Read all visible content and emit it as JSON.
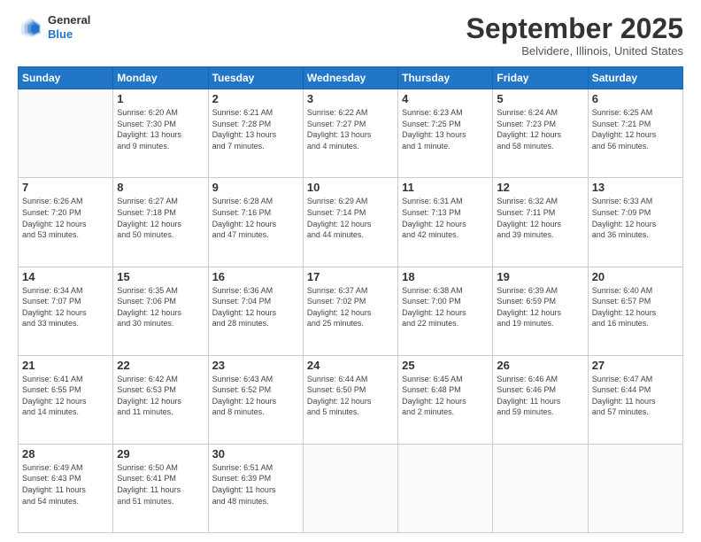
{
  "header": {
    "logo": {
      "general": "General",
      "blue": "Blue"
    },
    "title": "September 2025",
    "location": "Belvidere, Illinois, United States"
  },
  "calendar": {
    "headers": [
      "Sunday",
      "Monday",
      "Tuesday",
      "Wednesday",
      "Thursday",
      "Friday",
      "Saturday"
    ],
    "weeks": [
      [
        {
          "day": "",
          "info": ""
        },
        {
          "day": "1",
          "info": "Sunrise: 6:20 AM\nSunset: 7:30 PM\nDaylight: 13 hours\nand 9 minutes."
        },
        {
          "day": "2",
          "info": "Sunrise: 6:21 AM\nSunset: 7:28 PM\nDaylight: 13 hours\nand 7 minutes."
        },
        {
          "day": "3",
          "info": "Sunrise: 6:22 AM\nSunset: 7:27 PM\nDaylight: 13 hours\nand 4 minutes."
        },
        {
          "day": "4",
          "info": "Sunrise: 6:23 AM\nSunset: 7:25 PM\nDaylight: 13 hours\nand 1 minute."
        },
        {
          "day": "5",
          "info": "Sunrise: 6:24 AM\nSunset: 7:23 PM\nDaylight: 12 hours\nand 58 minutes."
        },
        {
          "day": "6",
          "info": "Sunrise: 6:25 AM\nSunset: 7:21 PM\nDaylight: 12 hours\nand 56 minutes."
        }
      ],
      [
        {
          "day": "7",
          "info": "Sunrise: 6:26 AM\nSunset: 7:20 PM\nDaylight: 12 hours\nand 53 minutes."
        },
        {
          "day": "8",
          "info": "Sunrise: 6:27 AM\nSunset: 7:18 PM\nDaylight: 12 hours\nand 50 minutes."
        },
        {
          "day": "9",
          "info": "Sunrise: 6:28 AM\nSunset: 7:16 PM\nDaylight: 12 hours\nand 47 minutes."
        },
        {
          "day": "10",
          "info": "Sunrise: 6:29 AM\nSunset: 7:14 PM\nDaylight: 12 hours\nand 44 minutes."
        },
        {
          "day": "11",
          "info": "Sunrise: 6:31 AM\nSunset: 7:13 PM\nDaylight: 12 hours\nand 42 minutes."
        },
        {
          "day": "12",
          "info": "Sunrise: 6:32 AM\nSunset: 7:11 PM\nDaylight: 12 hours\nand 39 minutes."
        },
        {
          "day": "13",
          "info": "Sunrise: 6:33 AM\nSunset: 7:09 PM\nDaylight: 12 hours\nand 36 minutes."
        }
      ],
      [
        {
          "day": "14",
          "info": "Sunrise: 6:34 AM\nSunset: 7:07 PM\nDaylight: 12 hours\nand 33 minutes."
        },
        {
          "day": "15",
          "info": "Sunrise: 6:35 AM\nSunset: 7:06 PM\nDaylight: 12 hours\nand 30 minutes."
        },
        {
          "day": "16",
          "info": "Sunrise: 6:36 AM\nSunset: 7:04 PM\nDaylight: 12 hours\nand 28 minutes."
        },
        {
          "day": "17",
          "info": "Sunrise: 6:37 AM\nSunset: 7:02 PM\nDaylight: 12 hours\nand 25 minutes."
        },
        {
          "day": "18",
          "info": "Sunrise: 6:38 AM\nSunset: 7:00 PM\nDaylight: 12 hours\nand 22 minutes."
        },
        {
          "day": "19",
          "info": "Sunrise: 6:39 AM\nSunset: 6:59 PM\nDaylight: 12 hours\nand 19 minutes."
        },
        {
          "day": "20",
          "info": "Sunrise: 6:40 AM\nSunset: 6:57 PM\nDaylight: 12 hours\nand 16 minutes."
        }
      ],
      [
        {
          "day": "21",
          "info": "Sunrise: 6:41 AM\nSunset: 6:55 PM\nDaylight: 12 hours\nand 14 minutes."
        },
        {
          "day": "22",
          "info": "Sunrise: 6:42 AM\nSunset: 6:53 PM\nDaylight: 12 hours\nand 11 minutes."
        },
        {
          "day": "23",
          "info": "Sunrise: 6:43 AM\nSunset: 6:52 PM\nDaylight: 12 hours\nand 8 minutes."
        },
        {
          "day": "24",
          "info": "Sunrise: 6:44 AM\nSunset: 6:50 PM\nDaylight: 12 hours\nand 5 minutes."
        },
        {
          "day": "25",
          "info": "Sunrise: 6:45 AM\nSunset: 6:48 PM\nDaylight: 12 hours\nand 2 minutes."
        },
        {
          "day": "26",
          "info": "Sunrise: 6:46 AM\nSunset: 6:46 PM\nDaylight: 11 hours\nand 59 minutes."
        },
        {
          "day": "27",
          "info": "Sunrise: 6:47 AM\nSunset: 6:44 PM\nDaylight: 11 hours\nand 57 minutes."
        }
      ],
      [
        {
          "day": "28",
          "info": "Sunrise: 6:49 AM\nSunset: 6:43 PM\nDaylight: 11 hours\nand 54 minutes."
        },
        {
          "day": "29",
          "info": "Sunrise: 6:50 AM\nSunset: 6:41 PM\nDaylight: 11 hours\nand 51 minutes."
        },
        {
          "day": "30",
          "info": "Sunrise: 6:51 AM\nSunset: 6:39 PM\nDaylight: 11 hours\nand 48 minutes."
        },
        {
          "day": "",
          "info": ""
        },
        {
          "day": "",
          "info": ""
        },
        {
          "day": "",
          "info": ""
        },
        {
          "day": "",
          "info": ""
        }
      ]
    ]
  }
}
